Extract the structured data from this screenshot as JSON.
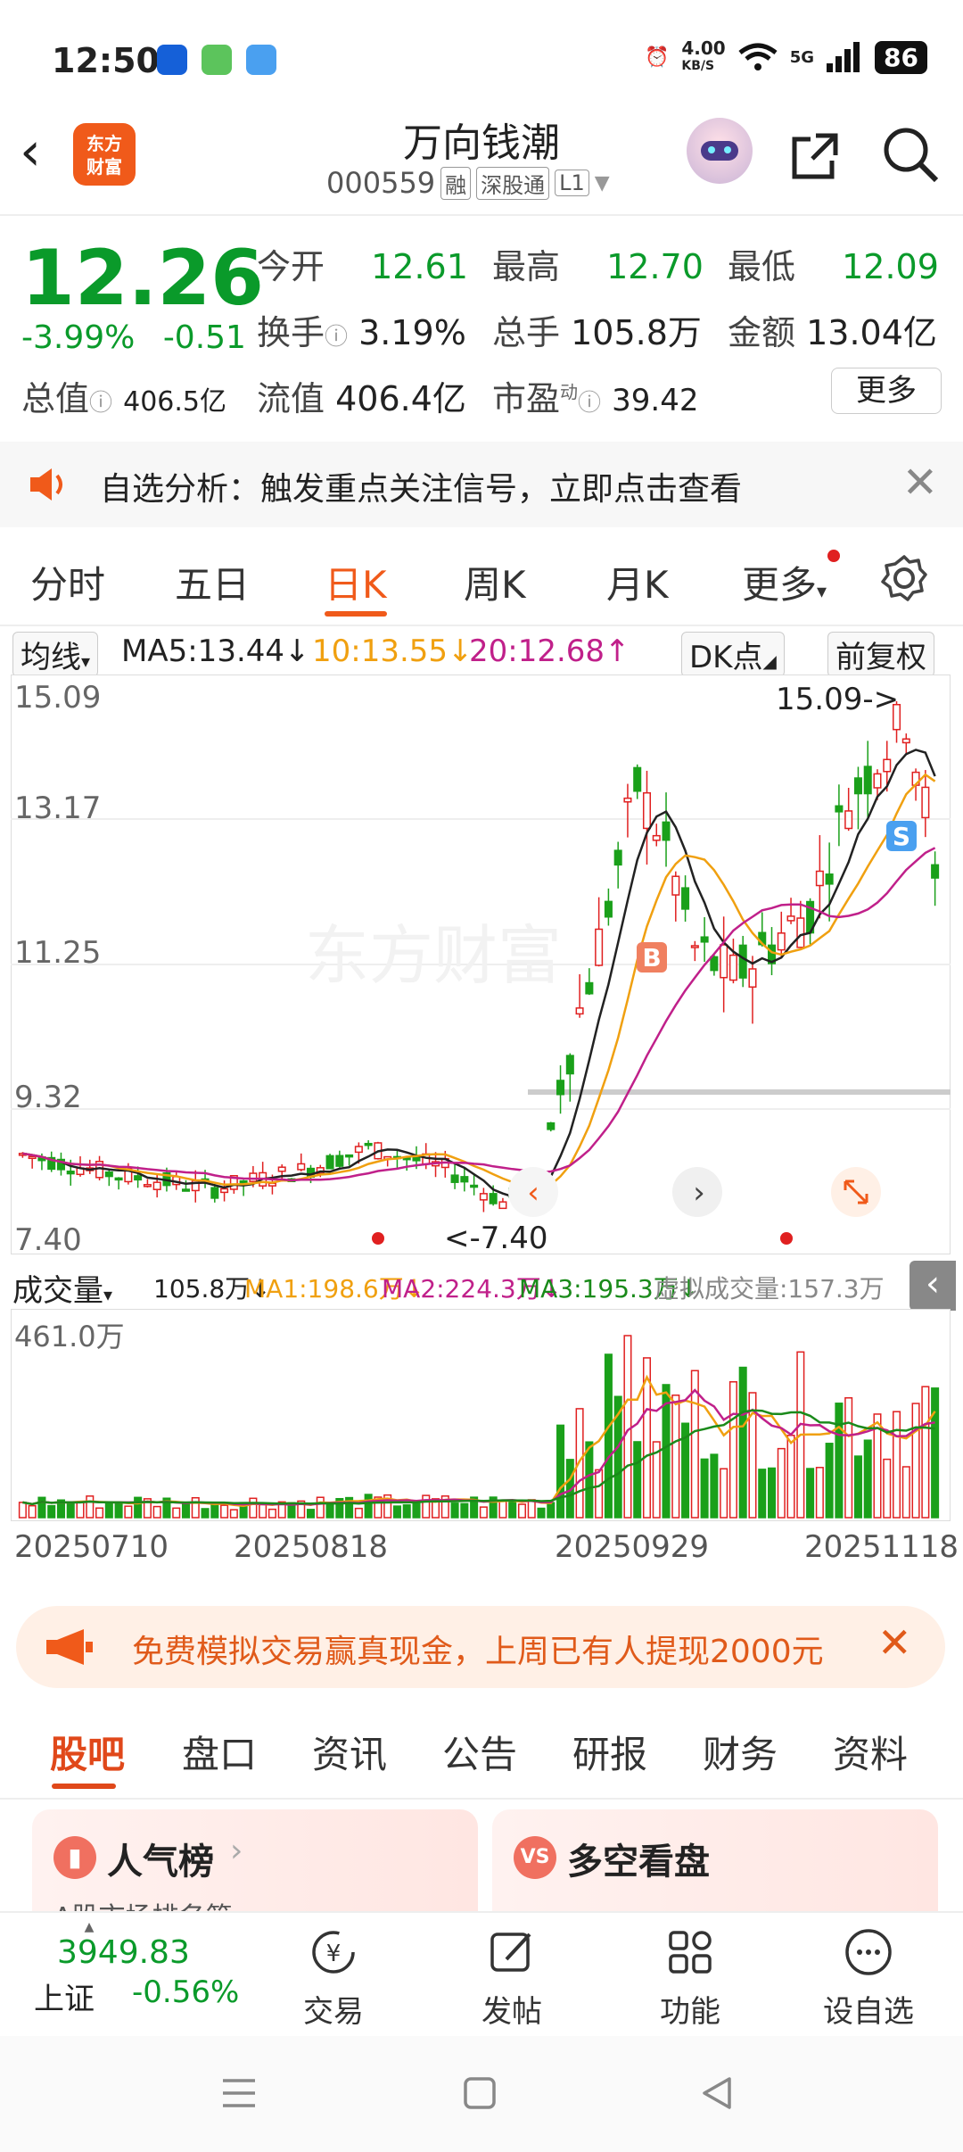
{
  "status_bar": {
    "time": "12:50",
    "net_speed": "4.00",
    "net_unit": "KB/S",
    "signal": "5G",
    "battery": "86"
  },
  "header": {
    "logo_text_top": "东方",
    "logo_text_bottom": "财富",
    "title": "万向钱潮",
    "code": "000559",
    "tag1": "融",
    "tag2": "深股通",
    "tag3": "L1"
  },
  "quote": {
    "price": "12.26",
    "change_pct": "-3.99%",
    "change_abs": "-0.51",
    "open_label": "今开",
    "open": "12.61",
    "high_label": "最高",
    "high": "12.70",
    "low_label": "最低",
    "low": "12.09",
    "turnover_label": "换手",
    "turnover": "3.19%",
    "volume_label": "总手",
    "volume": "105.8万",
    "amount_label": "金额",
    "amount": "13.04亿",
    "mktcap_label": "总值",
    "mktcap": "406.5亿",
    "float_label": "流值",
    "float": "406.4亿",
    "pe_label": "市盈",
    "pe_sup": "动",
    "pe": "39.42",
    "more": "更多"
  },
  "notice": {
    "text": "自选分析：触发重点关注信号，立即点击查看"
  },
  "tabs": [
    "分时",
    "五日",
    "日K",
    "周K",
    "月K",
    "更多"
  ],
  "tabs_active": "日K",
  "ma": {
    "selector": "均线",
    "ma5": "MA5:13.44↓",
    "ma10": "10:13.55↓",
    "ma20": "20:12.68↑",
    "dk": "DK点",
    "adjust": "前复权",
    "color_ma5": "#222222",
    "color_ma10": "#f0a010",
    "color_ma20": "#c0208a"
  },
  "kline": {
    "y_labels": [
      "15.09",
      "13.17",
      "11.25",
      "9.32",
      "7.40"
    ],
    "max_annot": "15.09->",
    "min_annot": "<-7.40",
    "buy_marker": "B",
    "sell_marker": "S",
    "watermark": "东方财富"
  },
  "volume": {
    "selector": "成交量",
    "vol": "105.8万↓",
    "ma1": "MA1:198.6万↓",
    "ma2": "MA2:224.3万↓",
    "ma3": "MA3:195.3万↓",
    "virtual": "虚拟成交量:157.3万",
    "max_label": "461.0万"
  },
  "dates": [
    "20250710",
    "20250818",
    "20250929",
    "20251118"
  ],
  "promo": {
    "text": "免费模拟交易赢真现金，上周已有人提现2000元"
  },
  "feed_tabs": [
    "股吧",
    "盘口",
    "资讯",
    "公告",
    "研报",
    "财务",
    "资料"
  ],
  "feed_tabs_active": "股吧",
  "cards": {
    "left_title": "人气榜",
    "right_title": "多空看盘",
    "left_sub": "A股市场排名第"
  },
  "bottom_nav": {
    "index_value": "3949.83",
    "index_name": "上证",
    "index_change": "-0.56%",
    "items": [
      "交易",
      "发帖",
      "功能",
      "设自选"
    ]
  }
}
